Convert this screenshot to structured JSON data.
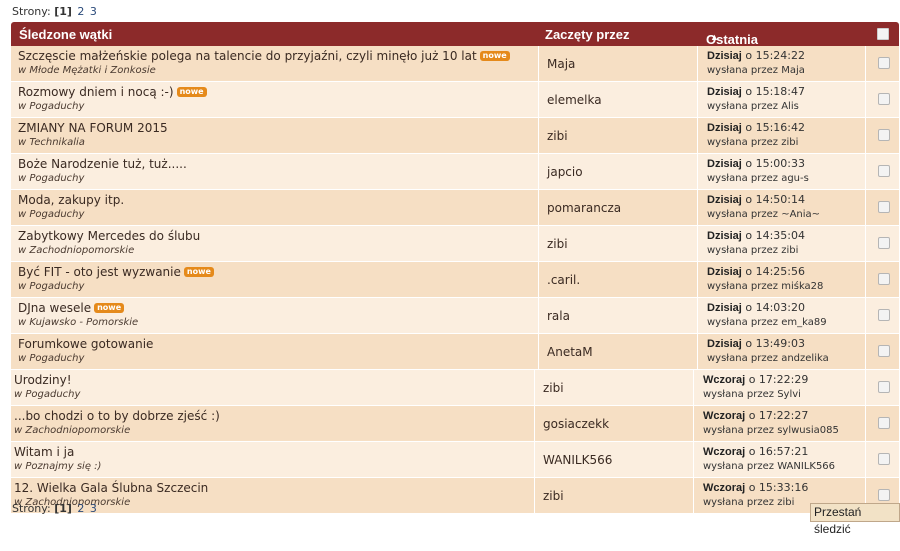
{
  "pagination": {
    "label": "Strony:",
    "current": "[1]",
    "pages": [
      "2",
      "3"
    ]
  },
  "table": {
    "headers": {
      "title": "Śledzone wątki",
      "started_by": "Zaczęty przez",
      "last_message": "Ostatnia wiadomość"
    },
    "rows": [
      {
        "title": "Szczęscie małżeńskie polega na talencie do przyjaźni, czyli minęło już 10 lat",
        "is_new": true,
        "forum": "w Młode Mężatki i Zonkosie",
        "starter": "Maja",
        "day": "Dzisiaj",
        "time": "o 15:24:22",
        "by": "wysłana przez Maja"
      },
      {
        "title": "Rozmowy dniem i nocą :-)",
        "is_new": true,
        "forum": "w Pogaduchy",
        "starter": "elemelka",
        "day": "Dzisiaj",
        "time": "o 15:18:47",
        "by": "wysłana przez Alis"
      },
      {
        "title": "ZMIANY NA FORUM 2015",
        "is_new": false,
        "forum": "w Technikalia",
        "starter": "zibi",
        "day": "Dzisiaj",
        "time": "o 15:16:42",
        "by": "wysłana przez zibi"
      },
      {
        "title": "Boże Narodzenie tuż, tuż.....",
        "is_new": false,
        "forum": "w Pogaduchy",
        "starter": "japcio",
        "day": "Dzisiaj",
        "time": "o 15:00:33",
        "by": "wysłana przez agu-s"
      },
      {
        "title": "Moda, zakupy itp.",
        "is_new": false,
        "forum": "w Pogaduchy",
        "starter": "pomarancza",
        "day": "Dzisiaj",
        "time": "o 14:50:14",
        "by": "wysłana przez ~Ania~"
      },
      {
        "title": "Zabytkowy Mercedes do ślubu",
        "is_new": false,
        "forum": "w Zachodniopomorskie",
        "starter": "zibi",
        "day": "Dzisiaj",
        "time": "o 14:35:04",
        "by": "wysłana przez zibi"
      },
      {
        "title": "Być FIT - oto jest wyzwanie",
        "is_new": true,
        "forum": "w Pogaduchy",
        "starter": ".caril.",
        "day": "Dzisiaj",
        "time": "o 14:25:56",
        "by": "wysłana przez miśka28"
      },
      {
        "title": "DJna wesele",
        "is_new": true,
        "forum": "w Kujawsko - Pomorskie",
        "starter": "rala",
        "day": "Dzisiaj",
        "time": "o 14:03:20",
        "by": "wysłana przez em_ka89"
      },
      {
        "title": "Forumkowe gotowanie",
        "is_new": false,
        "forum": "w Pogaduchy",
        "starter": "AnetaM",
        "day": "Dzisiaj",
        "time": "o 13:49:03",
        "by": "wysłana przez andzelika"
      },
      {
        "title": "Urodziny!",
        "is_new": false,
        "forum": "w Pogaduchy",
        "starter": "zibi",
        "day": "Wczoraj",
        "time": "o 17:22:29",
        "by": "wysłana przez Sylvi"
      },
      {
        "title": "...bo chodzi o to by dobrze zjeść :)",
        "is_new": false,
        "forum": "w Zachodniopomorskie",
        "starter": "gosiaczekk",
        "day": "Wczoraj",
        "time": "o 17:22:27",
        "by": "wysłana przez sylwusia085"
      },
      {
        "title": "Witam i ja",
        "is_new": false,
        "forum": "w Poznajmy się :)",
        "starter": "WANILK566",
        "day": "Wczoraj",
        "time": "o 16:57:21",
        "by": "wysłana przez WANILK566"
      },
      {
        "title": "12. Wielka Gala Ślubna Szczecin",
        "is_new": false,
        "forum": "w Zachodniopomorskie",
        "starter": "zibi",
        "day": "Wczoraj",
        "time": "o 15:33:16",
        "by": "wysłana przez zibi"
      }
    ]
  },
  "new_badge": "nowe",
  "stop_button": "Przestań śledzić",
  "colors": {
    "header_bg": "#8c2a2a",
    "row_odd": "#f6dfc4",
    "row_even": "#fbeedf",
    "badge": "#e58a1b"
  }
}
